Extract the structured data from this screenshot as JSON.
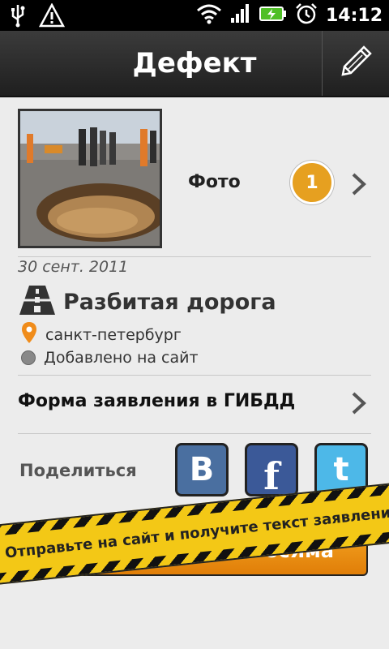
{
  "status_bar": {
    "time": "14:12",
    "icons": [
      "usb-icon",
      "warning-icon",
      "wifi-icon",
      "signal-icon",
      "battery-charging-icon",
      "alarm-icon"
    ]
  },
  "header": {
    "title": "Дефект",
    "edit_icon": "pencil-icon"
  },
  "photo_section": {
    "label": "Фото",
    "count": "1"
  },
  "defect": {
    "date": "30 сент. 2011",
    "type": "Разбитая дорога",
    "location": "санкт-петербург",
    "status": "Добавлено на сайт"
  },
  "form": {
    "label": "Форма заявления в ГИБДД"
  },
  "share": {
    "label": "Поделиться",
    "vk": "B",
    "facebook": "f",
    "twitter": "t"
  },
  "submit_button": {
    "label": "сайте РосЯма"
  },
  "tape_banner": {
    "text": "Отправьте на сайт и получите текст заявления"
  },
  "colors": {
    "accent": "#e6a020",
    "vk": "#4a6fa0",
    "facebook": "#3b5998",
    "twitter": "#4db8e8"
  }
}
